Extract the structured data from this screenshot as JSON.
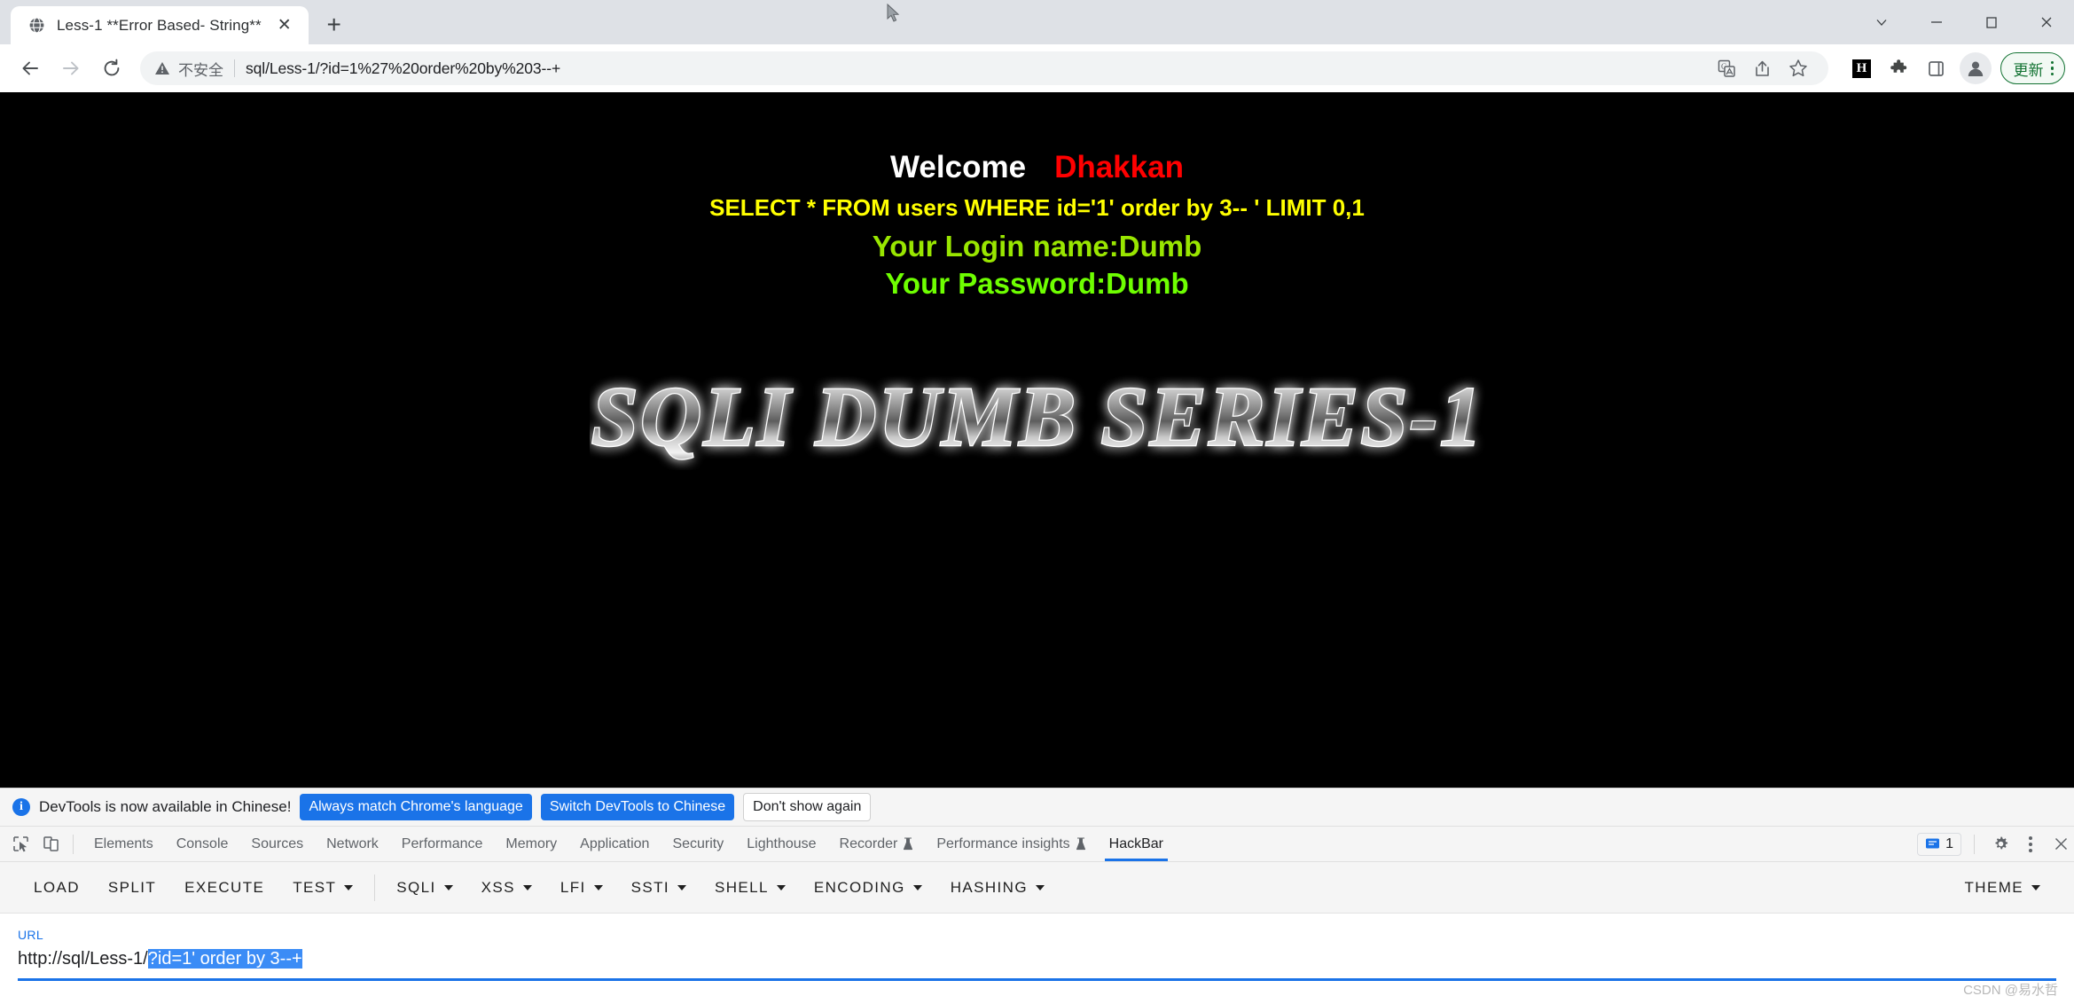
{
  "browser": {
    "tab": {
      "title": "Less-1 **Error Based- String**",
      "favicon_icon": "globe-icon",
      "close_icon": "close-icon"
    },
    "new_tab_icon": "plus-icon",
    "window_controls": {
      "tab_search_icon": "chevron-down-icon",
      "minimize_icon": "minimize-icon",
      "maximize_icon": "maximize-icon",
      "close_icon": "close-icon"
    },
    "nav": {
      "back_icon": "back-arrow-icon",
      "forward_icon": "forward-arrow-icon",
      "reload_icon": "reload-icon"
    },
    "omnibox": {
      "warning_icon": "warning-triangle-icon",
      "security_label": "不安全",
      "url": "sql/Less-1/?id=1%27%20order%20by%203--+",
      "translate_icon": "translate-icon",
      "share_icon": "share-icon",
      "bookmark_icon": "star-icon"
    },
    "extensions": {
      "hackbar_icon_label": "H",
      "puzzle_icon": "puzzle-piece-icon",
      "sidepanel_icon": "side-panel-icon"
    },
    "profile_icon": "avatar-icon",
    "update_button": {
      "label": "更新",
      "menu_icon": "vertical-dots-icon"
    }
  },
  "page": {
    "welcome": "Welcome",
    "username": "Dhakkan",
    "sql_query": "SELECT * FROM users WHERE id='1' order by 3-- ' LIMIT 0,1",
    "login_name": "Your Login name:Dumb",
    "password": "Your Password:Dumb",
    "logo_text": "SQLI DUMB SERIES-1",
    "colors": {
      "background": "#000000",
      "welcome": "#ffffff",
      "username": "#ff0000",
      "sql_query": "#ffff00",
      "login_name": "#99e600",
      "password": "#6eff00"
    }
  },
  "devtools": {
    "infobar": {
      "info_icon": "info-icon",
      "message": "DevTools is now available in Chinese!",
      "btn_always_match": "Always match Chrome's language",
      "btn_switch": "Switch DevTools to Chinese",
      "btn_dont_show": "Don't show again"
    },
    "left_icons": {
      "inspect_icon": "inspect-element-icon",
      "device_icon": "device-toolbar-icon"
    },
    "tabs": [
      {
        "label": "Elements",
        "experimental": false,
        "active": false
      },
      {
        "label": "Console",
        "experimental": false,
        "active": false
      },
      {
        "label": "Sources",
        "experimental": false,
        "active": false
      },
      {
        "label": "Network",
        "experimental": false,
        "active": false
      },
      {
        "label": "Performance",
        "experimental": false,
        "active": false
      },
      {
        "label": "Memory",
        "experimental": false,
        "active": false
      },
      {
        "label": "Application",
        "experimental": false,
        "active": false
      },
      {
        "label": "Security",
        "experimental": false,
        "active": false
      },
      {
        "label": "Lighthouse",
        "experimental": false,
        "active": false
      },
      {
        "label": "Recorder",
        "experimental": true,
        "active": false
      },
      {
        "label": "Performance insights",
        "experimental": true,
        "active": false
      },
      {
        "label": "HackBar",
        "experimental": false,
        "active": true
      }
    ],
    "right_controls": {
      "message_icon": "message-icon",
      "message_count": "1",
      "settings_icon": "gear-icon",
      "menu_icon": "vertical-dots-icon",
      "close_icon": "close-icon"
    }
  },
  "hackbar": {
    "buttons": [
      {
        "label": "LOAD",
        "dropdown": false
      },
      {
        "label": "SPLIT",
        "dropdown": false
      },
      {
        "label": "EXECUTE",
        "dropdown": false
      },
      {
        "label": "TEST",
        "dropdown": true
      },
      {
        "label": "SQLI",
        "dropdown": true
      },
      {
        "label": "XSS",
        "dropdown": true
      },
      {
        "label": "LFI",
        "dropdown": true
      },
      {
        "label": "SSTI",
        "dropdown": true
      },
      {
        "label": "SHELL",
        "dropdown": true
      },
      {
        "label": "ENCODING",
        "dropdown": true
      },
      {
        "label": "HASHING",
        "dropdown": true
      }
    ],
    "theme_button": {
      "label": "THEME",
      "dropdown": true
    },
    "url_field": {
      "label": "URL",
      "value_plain": "http://sql/Less-1/",
      "value_selected": "?id=1' order by 3--+"
    }
  },
  "watermark": "CSDN @易水哲"
}
